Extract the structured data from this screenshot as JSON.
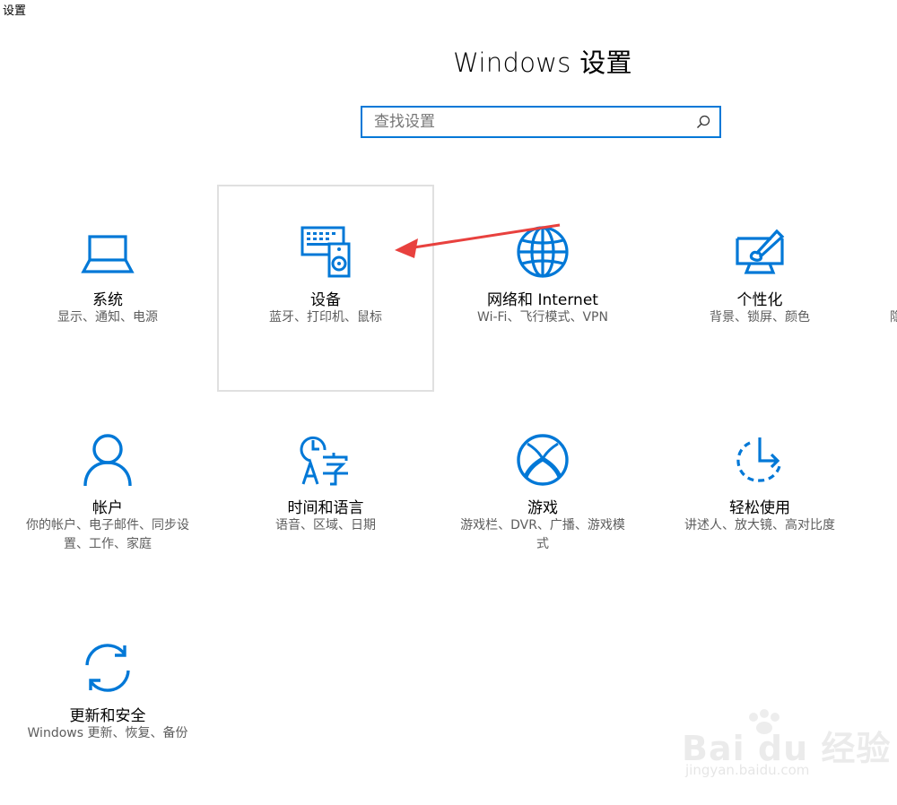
{
  "window": {
    "title": "设置"
  },
  "header": {
    "title": "Windows 设置"
  },
  "search": {
    "placeholder": "查找设置",
    "value": ""
  },
  "accent_color": "#0078d7",
  "annotation_color": "#e8413e",
  "tiles": [
    {
      "id": "system",
      "icon": "laptop-icon",
      "label": "系统",
      "desc": "显示、通知、电源"
    },
    {
      "id": "devices",
      "icon": "keyboard-speaker-icon",
      "label": "设备",
      "desc": "蓝牙、打印机、鼠标",
      "selected": true
    },
    {
      "id": "network",
      "icon": "globe-icon",
      "label": "网络和 Internet",
      "desc": "Wi-Fi、飞行模式、VPN"
    },
    {
      "id": "personalization",
      "icon": "paint-brush-icon",
      "label": "个性化",
      "desc": "背景、锁屏、颜色"
    },
    {
      "id": "accounts",
      "icon": "person-icon",
      "label": "帐户",
      "desc": "你的帐户、电子邮件、同步设置、工作、家庭"
    },
    {
      "id": "time-language",
      "icon": "time-language-icon",
      "label": "时间和语言",
      "desc": "语音、区域、日期"
    },
    {
      "id": "gaming",
      "icon": "xbox-icon",
      "label": "游戏",
      "desc": "游戏栏、DVR、广播、游戏模式"
    },
    {
      "id": "ease-of-access",
      "icon": "ease-of-access-icon",
      "label": "轻松使用",
      "desc": "讲述人、放大镜、高对比度"
    },
    {
      "id": "update-security",
      "icon": "sync-icon",
      "label": "更新和安全",
      "desc": "Windows 更新、恢复、备份"
    }
  ],
  "edge_tile": {
    "desc_fragment": "隐"
  },
  "watermark": {
    "logo_text": "Bai du 经验",
    "url_text": "jingyan.baidu.com"
  }
}
